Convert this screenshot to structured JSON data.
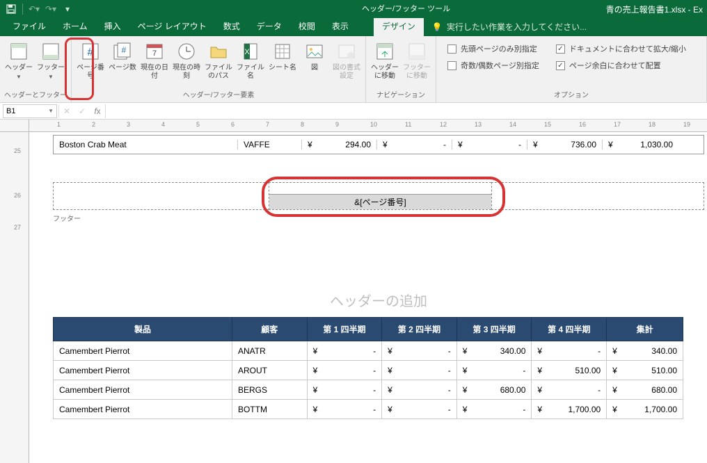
{
  "titlebar": {
    "context_tool": "ヘッダー/フッター ツール",
    "filename": "青の売上報告書1.xlsx - Ex"
  },
  "tabs": {
    "file": "ファイル",
    "home": "ホーム",
    "insert": "挿入",
    "page_layout": "ページ レイアウト",
    "formulas": "数式",
    "data": "データ",
    "review": "校閲",
    "view": "表示",
    "design": "デザイン",
    "tellme": "実行したい作業を入力してください..."
  },
  "ribbon": {
    "g1": {
      "header": "ヘッダー",
      "footer": "フッター",
      "label": "ヘッダーとフッター"
    },
    "g2": {
      "page_no": "ページ番号",
      "page_count": "ページ数",
      "date": "現在の日付",
      "time": "現在の時刻",
      "path": "ファイルのパス",
      "fname": "ファイル名",
      "sheet": "シート名",
      "pic": "図",
      "picfmt": "図の書式設定",
      "label": "ヘッダー/フッター要素"
    },
    "g3": {
      "goto_h": "ヘッダーに移動",
      "goto_f": "フッターに移動",
      "label": "ナビゲーション"
    },
    "g4": {
      "first_diff": "先頭ページのみ別指定",
      "odd_even": "奇数/偶数ページ別指定",
      "scale": "ドキュメントに合わせて拡大/縮小",
      "align": "ページ余白に合わせて配置",
      "label": "オプション"
    }
  },
  "fx": {
    "cell": "B1"
  },
  "ruler_h": [
    "1",
    "2",
    "3",
    "4",
    "5",
    "6",
    "7",
    "8",
    "9",
    "10",
    "11",
    "12",
    "13",
    "14",
    "15",
    "16",
    "17",
    "18",
    "19"
  ],
  "ruler_v": [
    "25",
    "26",
    "27"
  ],
  "top_row": {
    "product": "Boston Crab Meat",
    "customer": "VAFFE",
    "q1": "294.00",
    "q2": "-",
    "q3": "-",
    "q4": "736.00",
    "total": "1,030.00",
    "yen": "¥"
  },
  "footer": {
    "code": "&[ページ番号]",
    "label": "フッター"
  },
  "page2": {
    "header_add": "ヘッダーの追加",
    "cols": {
      "product": "製品",
      "customer": "顧客",
      "q1": "第 1 四半期",
      "q2": "第 2 四半期",
      "q3": "第 3 四半期",
      "q4": "第 4 四半期",
      "total": "集計"
    },
    "yen": "¥",
    "rows": [
      {
        "product": "Camembert Pierrot",
        "customer": "ANATR",
        "q1": "-",
        "q2": "-",
        "q3": "340.00",
        "q4": "-",
        "total": "340.00"
      },
      {
        "product": "Camembert Pierrot",
        "customer": "AROUT",
        "q1": "-",
        "q2": "-",
        "q3": "-",
        "q4": "510.00",
        "total": "510.00"
      },
      {
        "product": "Camembert Pierrot",
        "customer": "BERGS",
        "q1": "-",
        "q2": "-",
        "q3": "680.00",
        "q4": "-",
        "total": "680.00"
      },
      {
        "product": "Camembert Pierrot",
        "customer": "BOTTM",
        "q1": "-",
        "q2": "-",
        "q3": "-",
        "q4": "1,700.00",
        "total": "1,700.00"
      }
    ]
  }
}
